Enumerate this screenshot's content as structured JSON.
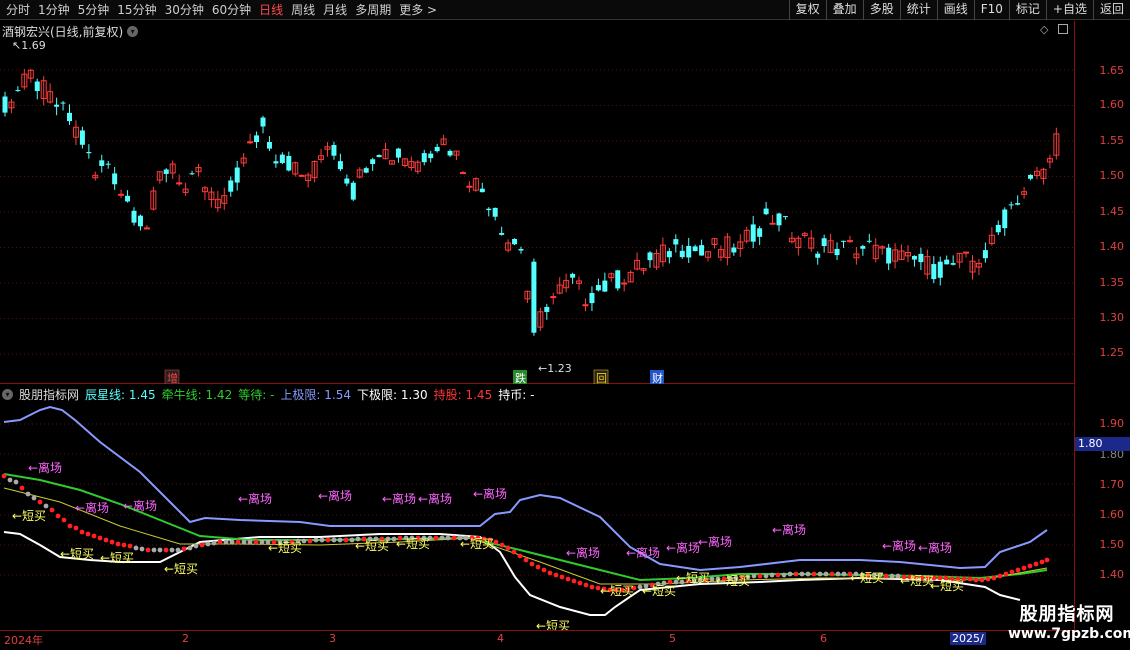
{
  "toolbar": {
    "periods": [
      "分时",
      "1分钟",
      "5分钟",
      "15分钟",
      "30分钟",
      "60分钟",
      "日线",
      "周线",
      "月线",
      "多周期",
      "更多 >"
    ],
    "active_period": "日线",
    "buttons": [
      "复权",
      "叠加",
      "多股",
      "统计",
      "画线",
      "F10",
      "标记",
      "+自选",
      "返回"
    ]
  },
  "main_chart": {
    "title": "酒钢宏兴(日线,前复权)",
    "high_marker": "1.69",
    "low_marker": "←1.23",
    "y_ticks": [
      "1.65",
      "1.60",
      "1.55",
      "1.50",
      "1.45",
      "1.40",
      "1.35",
      "1.30",
      "1.25"
    ],
    "markers": [
      {
        "text": "增",
        "color": "#ff4040"
      },
      {
        "text": "跌",
        "color": "#ffffff",
        "bg": "#2a8a2a"
      },
      {
        "text": "回",
        "color": "#ffcc00"
      },
      {
        "text": "财",
        "color": "#ffffff",
        "bg": "#2255cc"
      }
    ],
    "colors": {
      "up": "#ff3b3b",
      "down": "#54ffff"
    }
  },
  "indicator": {
    "name": "股朋指标网",
    "fields": [
      {
        "label": "辰星线:",
        "value": "1.45",
        "color": "#54ffff"
      },
      {
        "label": "牵牛线:",
        "value": "1.42",
        "color": "#2ecc2e"
      },
      {
        "label": "等待:",
        "value": "-",
        "color": "#2ecc2e"
      },
      {
        "label": "上极限:",
        "value": "1.54",
        "color": "#8899ff"
      },
      {
        "label": "下极限:",
        "value": "1.30",
        "color": "#ffffff"
      },
      {
        "label": "持股:",
        "value": "1.45",
        "color": "#ff3333"
      },
      {
        "label": "持币:",
        "value": "-",
        "color": "#ffffff"
      }
    ],
    "y_ticks": [
      "1.90",
      "1.80",
      "1.70",
      "1.60",
      "1.50",
      "1.40"
    ],
    "current_value": "1.80",
    "leave_label": "←离场",
    "buy_label": "←短买"
  },
  "date_axis": [
    {
      "label": "2024年"
    },
    {
      "label": "2"
    },
    {
      "label": "3"
    },
    {
      "label": "4"
    },
    {
      "label": "5"
    },
    {
      "label": "6"
    },
    {
      "label": "2025/"
    }
  ],
  "watermark": {
    "title": "股朋指标网",
    "url": "www.7gpzb.com"
  }
}
